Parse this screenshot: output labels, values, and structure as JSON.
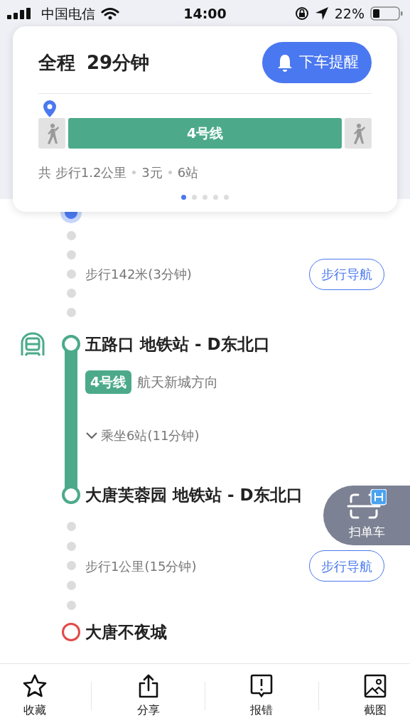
{
  "status_bar": {
    "carrier": "中国电信",
    "time": "14:00",
    "battery": "22%"
  },
  "summary": {
    "title": "全程",
    "duration": "29分钟",
    "remind_button": "下车提醒",
    "segments": [
      {
        "kind": "walk"
      },
      {
        "kind": "subway",
        "label": "4号线"
      },
      {
        "kind": "walk"
      }
    ],
    "stats": [
      "共 步行1.2公里",
      "3元",
      "6站"
    ],
    "pages": [
      {
        "selected": true
      },
      {
        "selected": false
      },
      {
        "selected": false
      },
      {
        "selected": false
      },
      {
        "selected": false
      }
    ]
  },
  "route": [
    {
      "kind": "origin"
    },
    {
      "kind": "walk",
      "text": "步行142米(3分钟)",
      "button": "步行导航"
    },
    {
      "kind": "station",
      "name": "五路口 地铁站 - D东北口"
    },
    {
      "kind": "line",
      "badge": "4号线",
      "direction": "航天新城方向"
    },
    {
      "kind": "ride",
      "text": "乘坐6站(11分钟)",
      "expanded": false
    },
    {
      "kind": "station",
      "name": "大唐芙蓉园 地铁站 - D东北口"
    },
    {
      "kind": "walk",
      "text": "步行1公里(15分钟)",
      "button": "步行导航"
    },
    {
      "kind": "destination",
      "name": "大唐不夜城"
    }
  ],
  "scan_button": "扫单车",
  "toolbar": [
    {
      "label": "收藏"
    },
    {
      "label": "分享"
    },
    {
      "label": "报错"
    },
    {
      "label": "截图"
    }
  ]
}
